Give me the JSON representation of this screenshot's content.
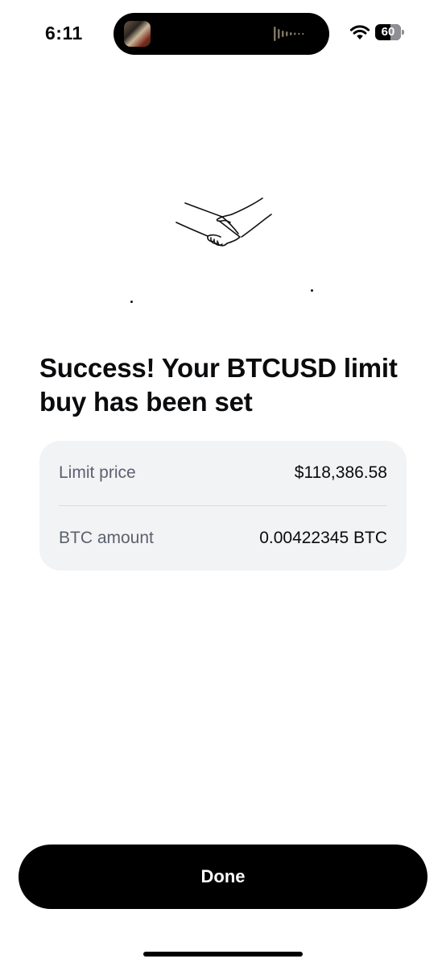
{
  "status_bar": {
    "time": "6:11",
    "battery_level": "60",
    "battery_fraction": 0.6,
    "icons": [
      "now-playing-artwork-icon",
      "audio-waveform-icon",
      "wifi-icon",
      "battery-icon"
    ]
  },
  "illustration": {
    "icon": "handshake-icon"
  },
  "confirmation": {
    "title": "Success! Your BTCUSD limit buy has been set"
  },
  "details": [
    {
      "label": "Limit price",
      "value": "$118,386.58"
    },
    {
      "label": "BTC amount",
      "value": "0.00422345 BTC"
    }
  ],
  "actions": {
    "done_label": "Done"
  },
  "colors": {
    "background": "#ffffff",
    "text_primary": "#0a0b0d",
    "text_secondary": "#5b616e",
    "card_background": "#f2f3f5",
    "button_background": "#000000",
    "button_text": "#ffffff"
  }
}
